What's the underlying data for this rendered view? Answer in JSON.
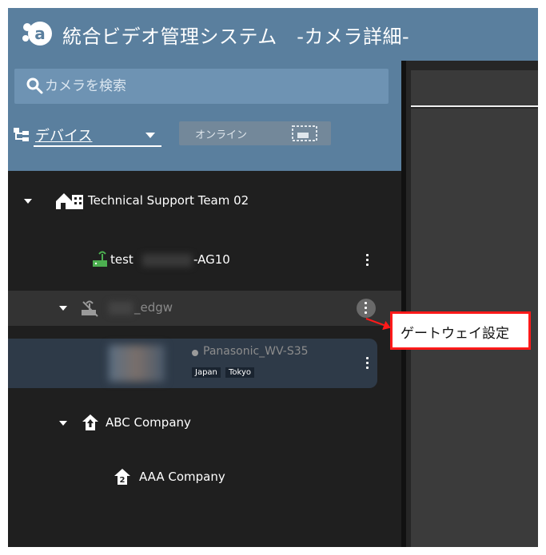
{
  "header": {
    "title": "統合ビデオ管理システム　-カメラ詳細-"
  },
  "search": {
    "placeholder": "カメラを検索"
  },
  "device_filter": {
    "selected": "デバイス",
    "online_label": "オンライン"
  },
  "tree": {
    "team": "Technical Support Team 02",
    "gateway1": {
      "prefix": "test",
      "suffix": "-AG10"
    },
    "gateway2": {
      "suffix": "_edgw"
    },
    "camera": {
      "name": "Panasonic_WV-S35",
      "tags": [
        "Japan",
        "Tokyo"
      ]
    },
    "company": "ABC Company",
    "subcompany": "AAA Company"
  },
  "context_menu": {
    "item": "ゲートウェイ設定"
  },
  "colors": {
    "header_blue": "#5a7f9e",
    "highlight_red": "#ff1a1a",
    "gateway_green": "#4caf50"
  },
  "icons": {
    "logo": "app-logo",
    "search": "search-icon",
    "tree": "tree-structure-icon",
    "monitor": "monitor-icon",
    "building": "building-icon",
    "router_online": "router-icon",
    "router_offline": "router-offline-icon",
    "home_up": "home-up-icon",
    "home_sub": "home-sub-icon"
  }
}
